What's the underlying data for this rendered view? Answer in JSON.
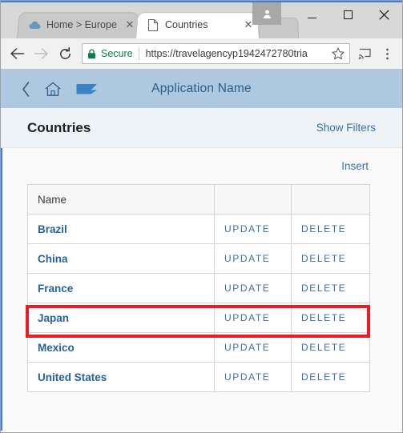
{
  "browser": {
    "tabs": [
      {
        "title": "Home > Europe (",
        "favicon": "cloud-icon",
        "active": false,
        "close_label": "✕"
      },
      {
        "title": "Countries",
        "favicon": "page-icon",
        "active": true,
        "close_label": "✕"
      }
    ],
    "window_controls": {
      "avatar_label": "profile-avatar",
      "minimize_label": "",
      "maximize_label": "",
      "close_label": "✕"
    },
    "toolbar": {
      "back_label": "←",
      "forward_label": "→",
      "reload_label": "⟳",
      "secure_label": "Secure",
      "url": "https://travelagencyp1942472780tria",
      "star_label": "☆",
      "cast_label": "cast-icon",
      "menu_label": "⋮"
    }
  },
  "app": {
    "header": {
      "back_label": "‹",
      "home_label": "home-icon",
      "flag_label": "flag-icon",
      "title": "Application Name"
    },
    "subheader": {
      "page_title": "Countries",
      "show_filters": "Show Filters"
    },
    "toolbar": {
      "insert_label": "Insert"
    },
    "table": {
      "columns": [
        "Name",
        "",
        ""
      ],
      "rows": [
        {
          "name": "Brazil",
          "update": "UPDATE",
          "delete": "DELETE",
          "highlighted": false
        },
        {
          "name": "China",
          "update": "UPDATE",
          "delete": "DELETE",
          "highlighted": false
        },
        {
          "name": "France",
          "update": "UPDATE",
          "delete": "DELETE",
          "highlighted": false
        },
        {
          "name": "Japan",
          "update": "UPDATE",
          "delete": "DELETE",
          "highlighted": true
        },
        {
          "name": "Mexico",
          "update": "UPDATE",
          "delete": "DELETE",
          "highlighted": false
        },
        {
          "name": "United States",
          "update": "UPDATE",
          "delete": "DELETE",
          "highlighted": false
        }
      ]
    },
    "colors": {
      "header_bg": "#aec8e0",
      "header_text": "#2e5d85",
      "link": "#3c6fa5",
      "row_name": "#27629c",
      "highlight": "#ea1c24",
      "secure_green": "#0b8043",
      "page_accent": "#3b7dd8"
    }
  }
}
